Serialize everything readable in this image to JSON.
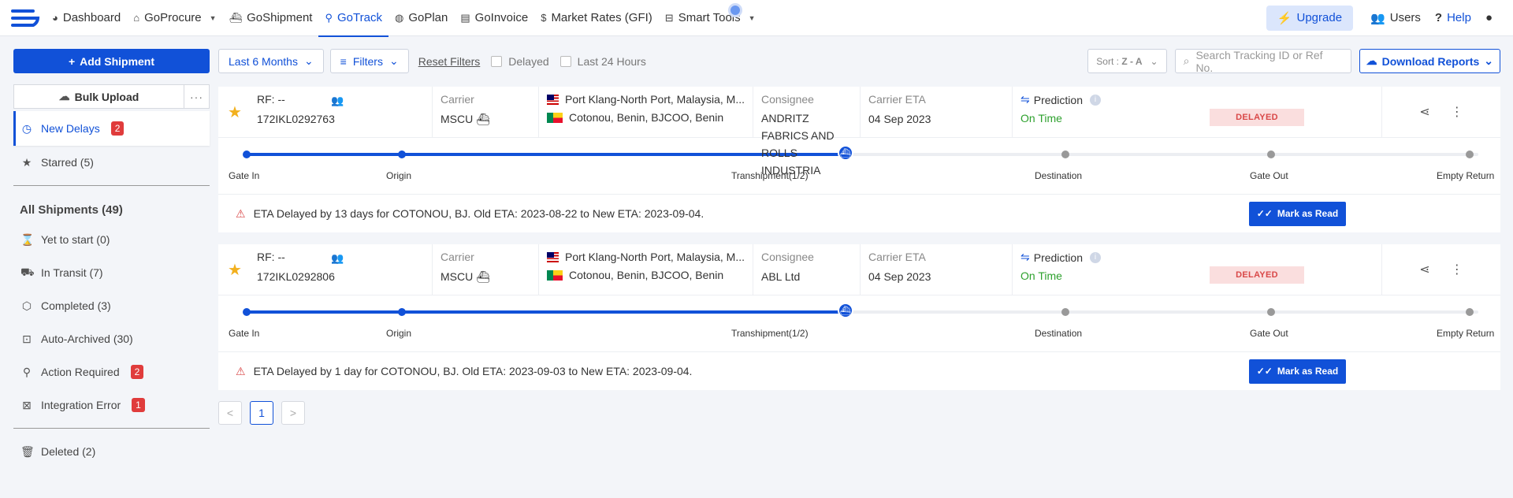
{
  "nav": {
    "items": [
      {
        "label": "Dashboard",
        "icon": "dashboard-icon"
      },
      {
        "label": "GoProcure",
        "icon": "home-icon"
      },
      {
        "label": "GoShipment",
        "icon": "ship-icon"
      },
      {
        "label": "GoTrack",
        "icon": "location-pin-icon"
      },
      {
        "label": "GoPlan",
        "icon": "globe-icon"
      },
      {
        "label": "GoInvoice",
        "icon": "document-icon"
      },
      {
        "label": "Market Rates (GFI)",
        "icon": "dollar-icon"
      },
      {
        "label": "Smart Tools",
        "icon": "toolbox-icon"
      }
    ],
    "upgrade": "Upgrade",
    "users": "Users",
    "help": "Help"
  },
  "sidebar": {
    "add_shipment": "Add Shipment",
    "bulk_upload": "Bulk Upload",
    "more": "···",
    "new_delays": {
      "label": "New Delays",
      "count": "2"
    },
    "starred": "Starred (5)",
    "all_shipments": "All Shipments (49)",
    "items": [
      {
        "label": "Yet to start (0)"
      },
      {
        "label": "In Transit (7)"
      },
      {
        "label": "Completed (3)"
      },
      {
        "label": "Auto-Archived (30)"
      },
      {
        "label": "Action Required",
        "badge": "2"
      },
      {
        "label": "Integration Error",
        "badge": "1"
      }
    ],
    "deleted": "Deleted (2)"
  },
  "toolbar": {
    "period": "Last 6 Months",
    "filters": "Filters",
    "reset": "Reset Filters",
    "delayed": "Delayed",
    "last24": "Last 24 Hours",
    "sort_label": "Sort :",
    "sort_value": "Z - A",
    "search_placeholder": "Search Tracking ID or Ref No.",
    "download": "Download Reports"
  },
  "labels": {
    "carrier": "Carrier",
    "consignee": "Consignee",
    "carrier_eta": "Carrier ETA",
    "prediction": "Prediction",
    "mark_read": "Mark as Read",
    "stages": [
      "Gate In",
      "Origin",
      "Transhipment(1/2)",
      "Destination",
      "Gate Out",
      "Empty Return"
    ]
  },
  "shipments": [
    {
      "rf": "RF: --",
      "tracking_id": "172IKL0292763",
      "carrier": "MSCU",
      "origin": "Port Klang-North Port, Malaysia, M...",
      "destination": "Cotonou, Benin, BJCOO, Benin",
      "consignee": "ANDRITZ FABRICS AND ROLLS INDUSTRIA",
      "carrier_eta": "04 Sep 2023",
      "prediction": "On Time",
      "status": "DELAYED",
      "alert": "ETA Delayed by 13 days for COTONOU, BJ. Old ETA: 2023-08-22 to New ETA: 2023-09-04."
    },
    {
      "rf": "RF: --",
      "tracking_id": "172IKL0292806",
      "carrier": "MSCU",
      "origin": "Port Klang-North Port, Malaysia, M...",
      "destination": "Cotonou, Benin, BJCOO, Benin",
      "consignee": "ABL Ltd",
      "carrier_eta": "04 Sep 2023",
      "prediction": "On Time",
      "status": "DELAYED",
      "alert": "ETA Delayed by 1 day for COTONOU, BJ. Old ETA: 2023-09-03 to New ETA: 2023-09-04."
    }
  ],
  "pager": {
    "prev": "<",
    "page": "1",
    "next": ">"
  }
}
